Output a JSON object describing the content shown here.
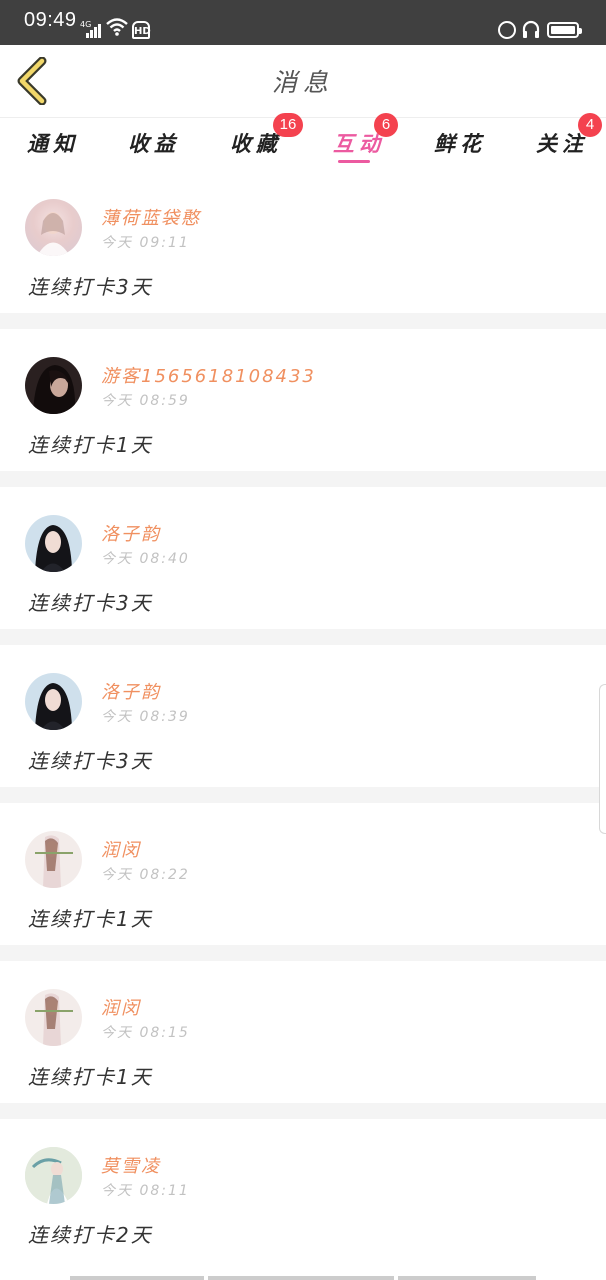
{
  "status_bar": {
    "time": "09:49",
    "network": "4G",
    "hd": "HD"
  },
  "header": {
    "title": "消息"
  },
  "tabs": [
    {
      "label": "通知",
      "badge": ""
    },
    {
      "label": "收益",
      "badge": ""
    },
    {
      "label": "收藏",
      "badge": "16"
    },
    {
      "label": "互动",
      "badge": "6",
      "active": true
    },
    {
      "label": "鲜花",
      "badge": ""
    },
    {
      "label": "关注",
      "badge": "4"
    }
  ],
  "messages": [
    {
      "name": "薄荷蓝袋憨",
      "time": "今天  09:11",
      "text": "连续打卡3天"
    },
    {
      "name": "游客15656181084​33",
      "time": "今天  08:59",
      "text": "连续打卡1天"
    },
    {
      "name": "洛子韵",
      "time": "今天  08:40",
      "text": "连续打卡3天"
    },
    {
      "name": "洛子韵",
      "time": "今天  08:39",
      "text": "连续打卡3天"
    },
    {
      "name": "润闵",
      "time": "今天  08:22",
      "text": "连续打卡1天"
    },
    {
      "name": "润闵",
      "time": "今天  08:15",
      "text": "连续打卡1天"
    },
    {
      "name": "莫雪凌",
      "time": "今天  08:11",
      "text": "连续打卡2天"
    }
  ],
  "colors": {
    "accent": "#ec5aa0",
    "badge": "#f4424f",
    "username": "#f09060"
  }
}
